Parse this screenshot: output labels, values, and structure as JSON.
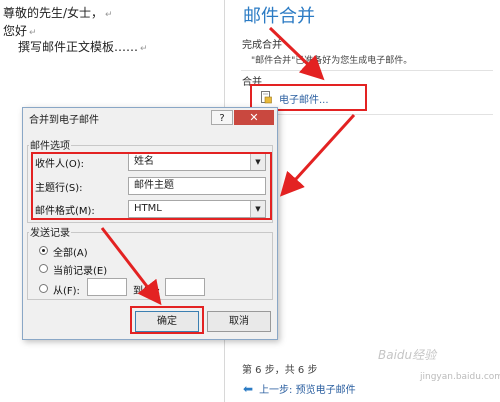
{
  "document": {
    "line1": "尊敬的先生/女士，",
    "line2": "您好",
    "line3": "撰写邮件正文模板……",
    "para_mark": "↵"
  },
  "pane": {
    "title": "邮件合并",
    "section_complete": "完成合并",
    "complete_note": "\"邮件合并\"已准备好为您生成电子邮件。",
    "section_merge": "合并",
    "email_link": "电子邮件...",
    "step_text": "第 6 步，共 6 步",
    "prev_arrow": "⬅",
    "prev_link": "上一步: 预览电子邮件"
  },
  "dialog": {
    "title": "合并到电子邮件",
    "help": "?",
    "close": "✕",
    "group_mail_options": "邮件选项",
    "recipient_label": "收件人(O):",
    "recipient_value": "姓名",
    "subject_label": "主题行(S):",
    "subject_value": "邮件主题",
    "format_label": "邮件格式(M):",
    "format_value": "HTML",
    "group_send_records": "发送记录",
    "radio_all": "全部(A)",
    "radio_current": "当前记录(E)",
    "radio_from": "从(F):",
    "to_label": "到(T):",
    "from_value": "",
    "to_value": "",
    "ok": "确定",
    "cancel": "取消"
  },
  "watermark": {
    "text": "Baidu经验",
    "url": "jingyan.baidu.com"
  },
  "colors": {
    "accent": "#2b7bc4",
    "highlight": "#e32222"
  }
}
